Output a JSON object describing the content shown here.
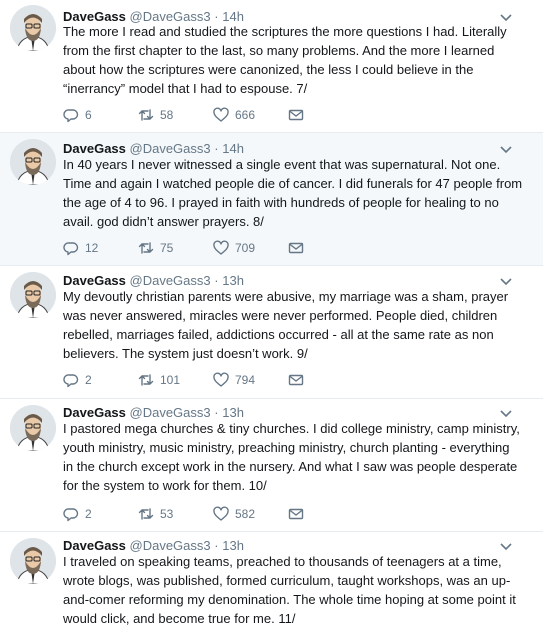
{
  "tweets": [
    {
      "name": "DaveGass",
      "handle": "@DaveGass3",
      "separator": "·",
      "time": "14h",
      "text": "The more I read and studied the scriptures the more questions I had. Literally from the first chapter to the last, so many problems. And the more I learned about how the scriptures were canonized, the less I could believe in the “inerrancy” model that I had to espouse. 7/",
      "replies": "6",
      "retweets": "58",
      "likes": "666"
    },
    {
      "name": "DaveGass",
      "handle": "@DaveGass3",
      "separator": "·",
      "time": "14h",
      "text": "In 40 years I never witnessed a single event that was supernatural. Not one. Time and again I watched people die of cancer. I did funerals for 47 people from the age of 4 to 96. I prayed in faith with hundreds of people for healing to no avail. god didn’t answer prayers. 8/",
      "replies": "12",
      "retweets": "75",
      "likes": "709"
    },
    {
      "name": "DaveGass",
      "handle": "@DaveGass3",
      "separator": "·",
      "time": "13h",
      "text": "My devoutly christian parents were abusive, my marriage was a sham, prayer was never answered, miracles were never performed. People died, children rebelled, marriages failed, addictions occurred - all at the same rate as non believers. The system just doesn’t work. 9/",
      "replies": "2",
      "retweets": "101",
      "likes": "794"
    },
    {
      "name": "DaveGass",
      "handle": "@DaveGass3",
      "separator": "·",
      "time": "13h",
      "text": "I pastored mega churches & tiny churches. I did college ministry, camp ministry, youth ministry, music ministry, preaching ministry, church planting - everything in the church except work in the nursery. And what I saw was people desperate for the system to work for them. 10/",
      "replies": "2",
      "retweets": "53",
      "likes": "582"
    },
    {
      "name": "DaveGass",
      "handle": "@DaveGass3",
      "separator": "·",
      "time": "13h",
      "text": "I traveled on speaking teams, preached to thousands of teenagers at a time, wrote blogs, was published, formed curriculum, taught workshops, was an up-and-comer reforming my denomination. The whole time hoping at some point it would click, and become true for me. 11/"
    }
  ],
  "icons": {
    "reply": "reply-icon",
    "retweet": "retweet-icon",
    "like": "heart-icon",
    "dm": "envelope-icon",
    "caret": "chevron-down-icon"
  },
  "colors": {
    "name": "#14171a",
    "secondary": "#657786",
    "highlight_bg": "#f5f8fa",
    "thread_line": "#ccd6dd"
  }
}
